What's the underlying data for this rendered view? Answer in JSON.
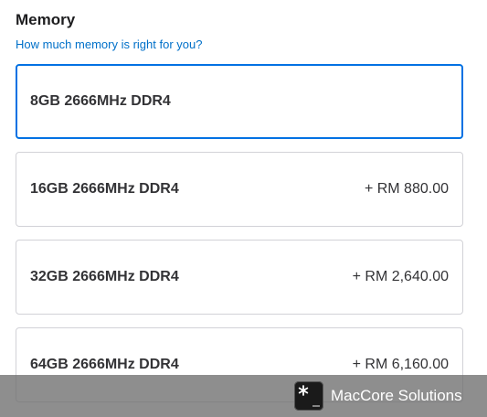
{
  "section": {
    "title": "Memory",
    "help_link": "How much memory is right for you?"
  },
  "options": [
    {
      "label": "8GB 2666MHz DDR4",
      "price": "",
      "selected": true
    },
    {
      "label": "16GB 2666MHz DDR4",
      "price": "+ RM 880.00",
      "selected": false
    },
    {
      "label": "32GB 2666MHz DDR4",
      "price": "+ RM 2,640.00",
      "selected": false
    },
    {
      "label": "64GB 2666MHz DDR4",
      "price": "+ RM 6,160.00",
      "selected": false
    }
  ],
  "watermark": {
    "text": "MacCore Solutions",
    "logo_icon": "terminal-asterisk-icon"
  },
  "colors": {
    "link": "#0070c9",
    "selected_border": "#0071e3",
    "option_border": "#d2d2d7",
    "text": "#1d1d1f"
  }
}
